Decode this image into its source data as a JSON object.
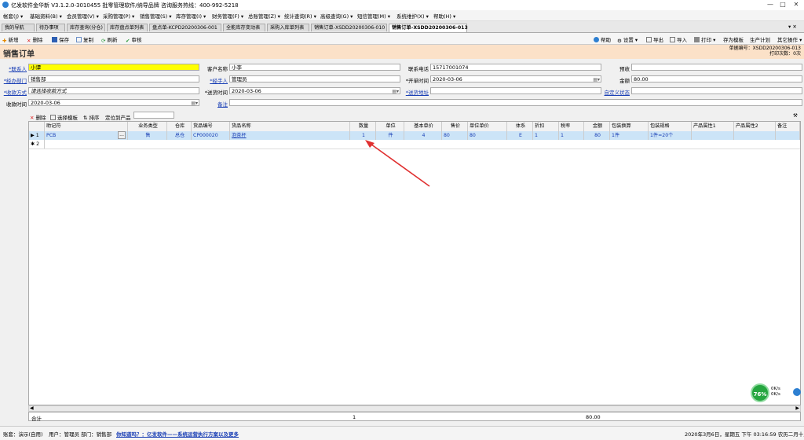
{
  "window": {
    "title": "亿发软件金华新 V3.1.2.0-3010455 批零管理软件/纳导品牌 咨询服务热线：400-992-5218",
    "min": "—",
    "max": "□",
    "close": "✕"
  },
  "menu": [
    "帐套(J) ▾",
    "基础资料(B) ▾",
    "会员管理(V) ▾",
    "采购管理(P) ▾",
    "销售管理(S) ▾",
    "库存管理(I) ▾",
    "财务管理(F) ▾",
    "总账管理(Z) ▾",
    "统计查询(R) ▾",
    "高级查询(G) ▾",
    "短信管理(M) ▾",
    "系统维护(X) ▾",
    "帮助(H) ▾"
  ],
  "tabs": [
    "我的导航",
    "待办事项",
    "库存查询(分仓)",
    "库存盘点单列表",
    "盘点单-KCPD20200306-001",
    "全能库存变动表",
    "采购入库单列表",
    "销售订单-XSDD20200306-010",
    "销售订单-XSDD20200306-013"
  ],
  "tab_controls": "▾ ✕",
  "toolbar": {
    "new": "新增",
    "delete": "删除",
    "save": "保存",
    "copy": "复制",
    "refresh": "刷新",
    "audit": "审核",
    "help": "帮助",
    "settings": "设置 ▾",
    "export": "导出",
    "import": "导入",
    "print": "打印 ▾",
    "template": "存为模板",
    "produce": "生产计划",
    "other": "其它操作 ▾"
  },
  "header": {
    "title": "销售订单",
    "doc_no": "单据编号：XSDD20200306-013",
    "print_count": "打印次数：0次"
  },
  "form": {
    "contact_label": "*联系人",
    "contact_value": "小谭",
    "customer_label": "客户名称",
    "customer_value": "小李",
    "phone_label": "联系电话",
    "phone_value": "15717001074",
    "prepay_label": "预收",
    "prepay_value": "",
    "dept_label": "*经办部门",
    "dept_value": "销售部",
    "handler_label": "*经手人",
    "handler_value": "管理员",
    "orderdate_label": "*开单时间",
    "orderdate_value": "2020-03-06",
    "amount_label": "金额",
    "amount_value": "80.00",
    "paymethod_label": "*收款方式",
    "paymethod_value": "请选择收款方式",
    "deliverdate_label": "*送货时间",
    "deliverdate_value": "2020-03-06",
    "address_label": "*送货地址",
    "address_value": "",
    "custom_label": "自定义状态",
    "custom_value": "",
    "collectdate_label": "收款时间",
    "collectdate_value": "2020-03-06",
    "remark_label": "备注",
    "remark_value": ""
  },
  "gridtool": {
    "delete": "删除",
    "template": "选择模板",
    "sort": "排序",
    "locate": "定位到产品"
  },
  "grid": {
    "columns": [
      "助记符",
      "业务类型",
      "仓库",
      "货品编号",
      "货品名称",
      "数量",
      "单位",
      "基本单价",
      "售价",
      "单位单价",
      "体系",
      "折扣",
      "税率",
      "金额",
      "包装换算",
      "包装规格",
      "产品属性1",
      "产品属性2",
      "备注"
    ],
    "row1": {
      "num": "1",
      "code": "PCB",
      "type": "售",
      "warehouse": "总仓",
      "item_no": "CP000020",
      "item_name": "泡茶杯",
      "qty": "1",
      "unit": "件",
      "base_price": "4",
      "price": "80",
      "unit_price": "80",
      "system": "E",
      "discount": "1",
      "tax": "1",
      "amount": "80",
      "pack_conv": "1件",
      "pack_spec": "1件=20个",
      "attr1": "",
      "attr2": "",
      "remark": ""
    },
    "row2": {
      "num": "2"
    },
    "footer": {
      "label": "合计",
      "qty": "1",
      "amount": "80.00"
    }
  },
  "perf": {
    "percent": "76%",
    "up": "0K/s",
    "down": "0K/s"
  },
  "status": {
    "account": "账套：演示(自用)",
    "user": "用户：管理员  部门：销售部",
    "promo": "你知道吗？：亿发软件——系统运营执行方案以及更多",
    "datetime": "2020年3月6日，星期五 下午 03:16:59 农历二月十三"
  },
  "colors": {
    "header_bg": "#fbe1c8",
    "highlight": "#ffff00",
    "row_selected": "#cce4f7",
    "arrow": "#e03030",
    "link": "#1a3fb5"
  }
}
